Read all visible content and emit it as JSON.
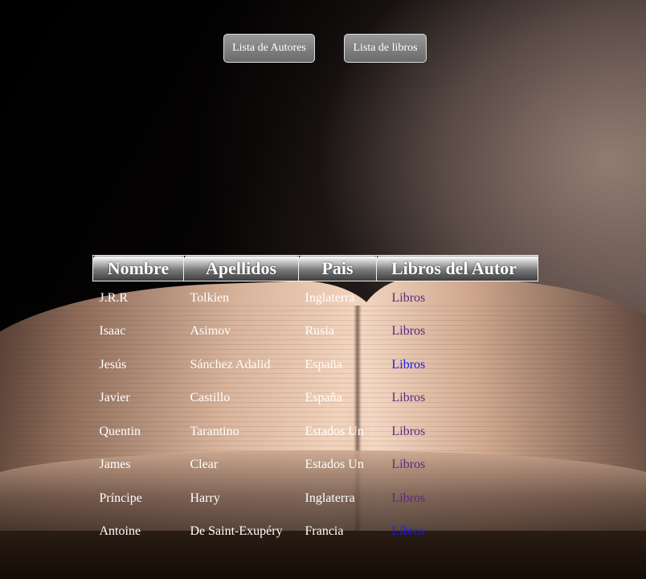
{
  "nav": {
    "authors_label": "Lista de Autores",
    "books_label": "Lista de libros"
  },
  "table": {
    "headers": [
      "Nombre",
      "Apellidos",
      "Pais",
      "Libros del Autor"
    ],
    "rows": [
      {
        "nombre": "J.R.R",
        "apellidos": "Tolkien",
        "pais": "Inglaterra",
        "libros": "Libros",
        "link_state": "visited"
      },
      {
        "nombre": "Isaac",
        "apellidos": "Asimov",
        "pais": "Rusia",
        "libros": "Libros",
        "link_state": "visited"
      },
      {
        "nombre": "Jesús",
        "apellidos": "Sánchez Adalid",
        "pais": "España",
        "libros": "Libros",
        "link_state": "unvisited"
      },
      {
        "nombre": "Javier",
        "apellidos": "Castillo",
        "pais": "España",
        "libros": "Libros",
        "link_state": "visited"
      },
      {
        "nombre": "Quentin",
        "apellidos": "Tarantino",
        "pais": "Estados Un",
        "libros": "Libros",
        "link_state": "visited"
      },
      {
        "nombre": "James",
        "apellidos": "Clear",
        "pais": "Estados Un",
        "libros": "Libros",
        "link_state": "visited"
      },
      {
        "nombre": "Príncipe",
        "apellidos": "Harry",
        "pais": "Inglaterra",
        "libros": "Libros",
        "link_state": "visited"
      },
      {
        "nombre": "Antoine",
        "apellidos": "De Saint-Exupéry",
        "pais": "Francia",
        "libros": "Libros",
        "link_state": "unvisited"
      }
    ]
  },
  "colors": {
    "link_visited": "#5a2a80",
    "link_unvisited": "#1a1aee",
    "text": "#ffffff"
  }
}
